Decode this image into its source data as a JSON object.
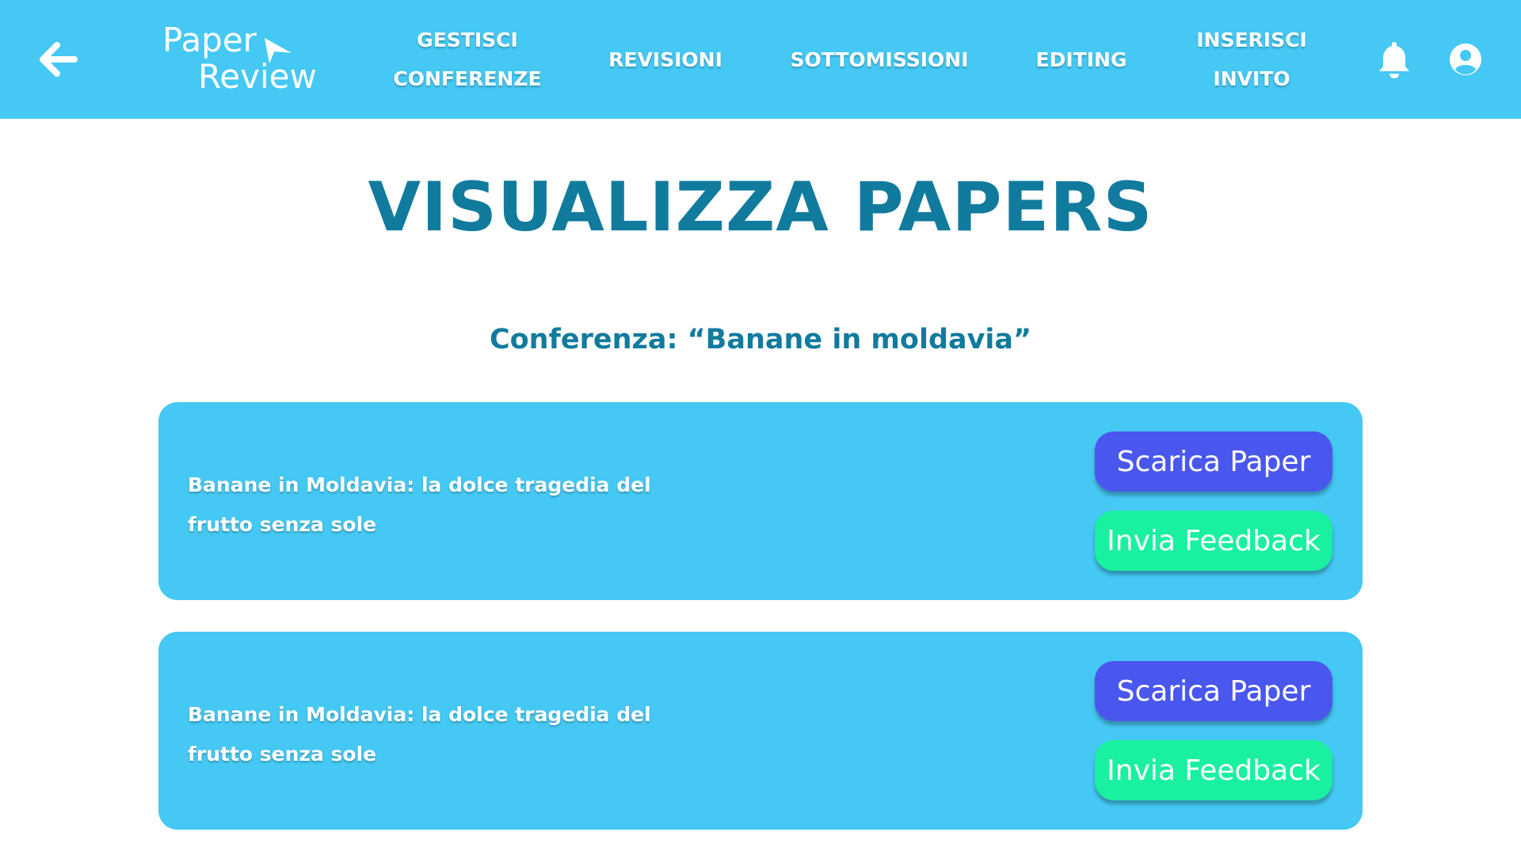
{
  "header": {
    "logo_line1": "Paper",
    "logo_line2": "Review",
    "nav": [
      {
        "label_line1": "GESTISCI",
        "label_line2": "CONFERENZE"
      },
      {
        "label_line1": "REVISIONI",
        "label_line2": ""
      },
      {
        "label_line1": "SOTTOMISSIONI",
        "label_line2": ""
      },
      {
        "label_line1": "EDITING",
        "label_line2": ""
      },
      {
        "label_line1": "INSERISCI",
        "label_line2": "INVITO"
      }
    ],
    "icons": [
      "back-arrow-icon",
      "bell-icon",
      "user-avatar-icon"
    ]
  },
  "main": {
    "title": "VISUALIZZA PAPERS",
    "conference_label": "Conferenza: “Banane in moldavia”",
    "papers": [
      {
        "title": "Banane in Moldavia: la dolce tragedia del frutto senza sole",
        "download_label": "Scarica Paper",
        "feedback_label": "Invia Feedback"
      },
      {
        "title": "Banane in Moldavia: la dolce tragedia del frutto senza sole",
        "download_label": "Scarica Paper",
        "feedback_label": "Invia Feedback"
      }
    ]
  },
  "colors": {
    "header_bg": "#45c8f3",
    "title": "#117b9e",
    "card_bg": "#45c8f3",
    "download_button": "#4a57ef",
    "feedback_button": "#19f0a0"
  }
}
